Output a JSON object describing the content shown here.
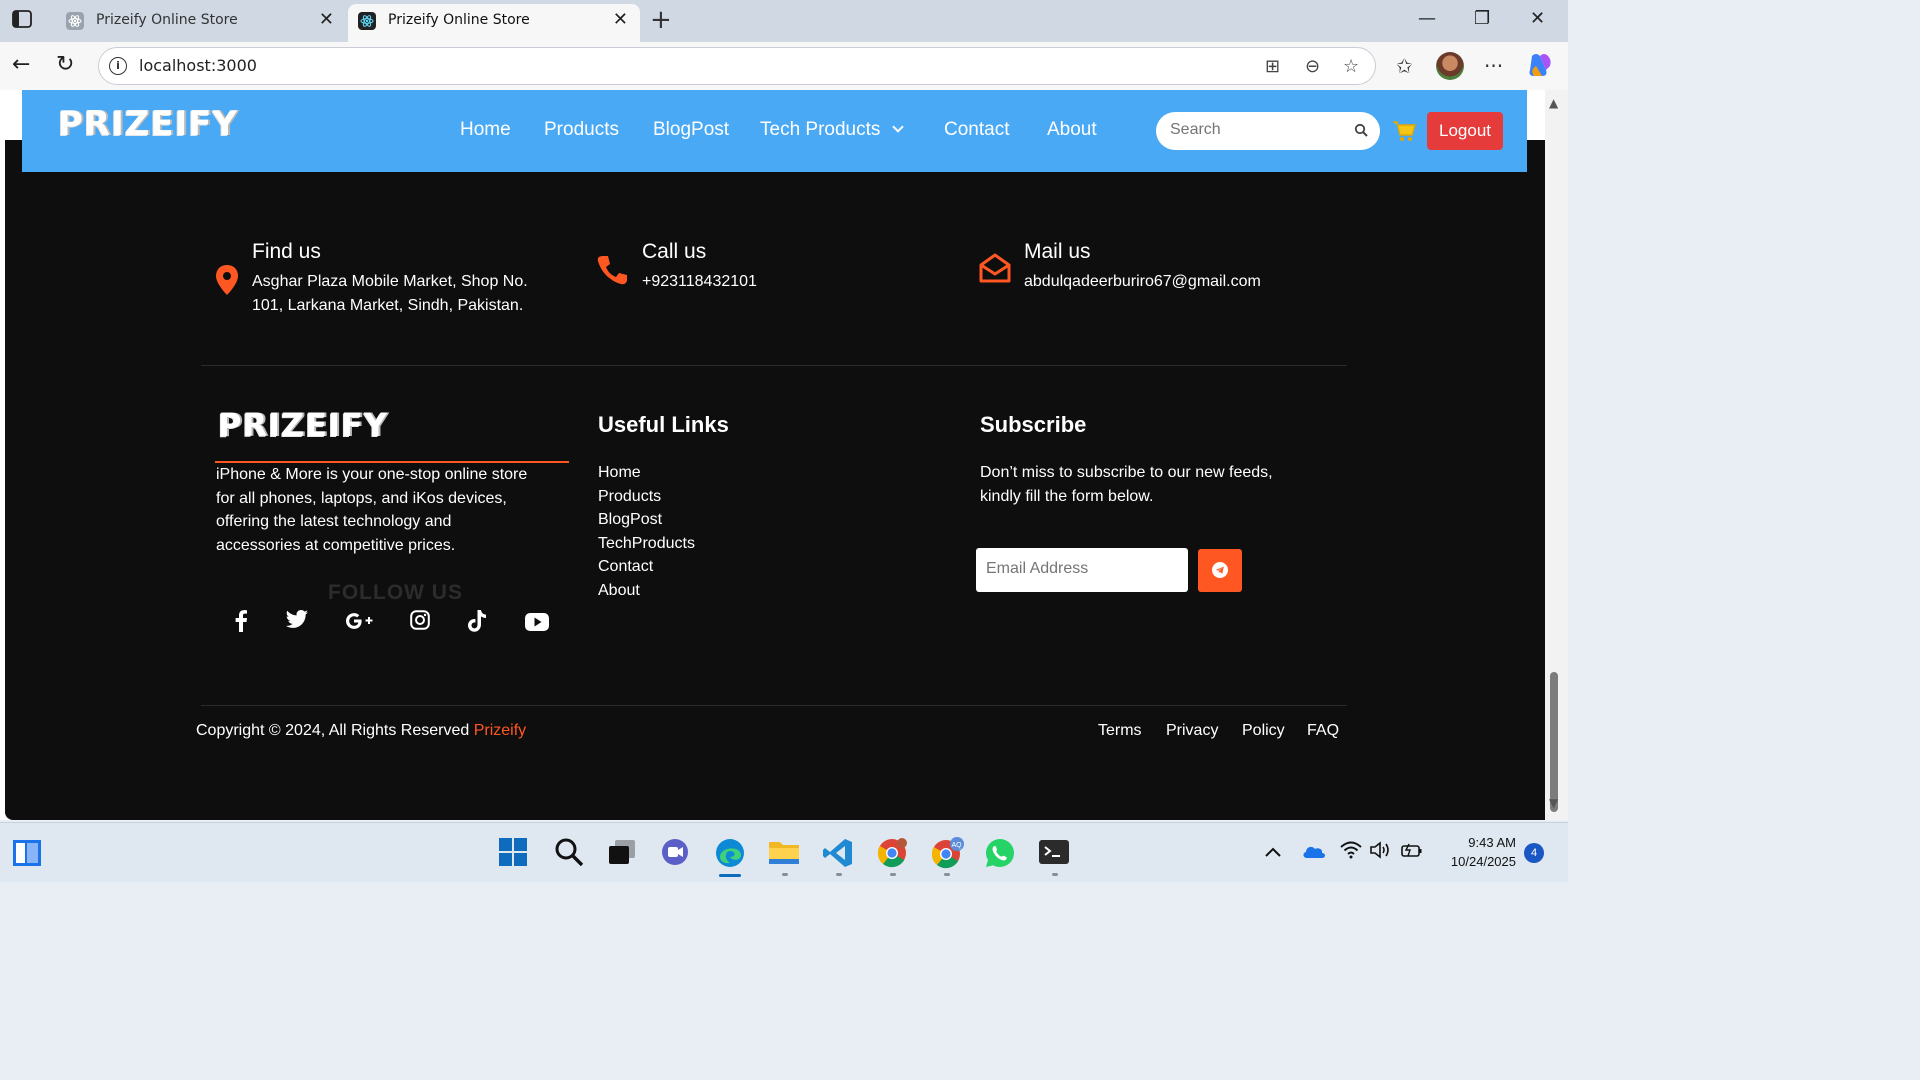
{
  "browser": {
    "tabs": [
      {
        "title": "Prizeify Online Store",
        "active": false
      },
      {
        "title": "Prizeify Online Store",
        "active": true
      }
    ],
    "url": "localhost:3000"
  },
  "site": {
    "logo": "PRIZEIFY",
    "nav": [
      "Home",
      "Products",
      "BlogPost",
      "Tech Products",
      "Contact",
      "About"
    ],
    "search_placeholder": "Search",
    "logout_label": "Logout",
    "accent_color": "#ff5722",
    "nav_color": "#4aa9f5"
  },
  "contact": {
    "find": {
      "title": "Find us",
      "line1": "Asghar Plaza Mobile Market, Shop No.",
      "line2": "101, Larkana Market, Sindh, Pakistan."
    },
    "call": {
      "title": "Call us",
      "value": "+923118432101"
    },
    "mail": {
      "title": "Mail us",
      "value": "abdulqadeerburiro67@gmail.com"
    }
  },
  "footer": {
    "logo": "PRIZEIFY",
    "about": [
      "iPhone & More is your one-stop online store",
      "for all phones, laptops, and iKos devices,",
      "offering the latest technology and",
      "accessories at competitive prices."
    ],
    "follow_title": "FOLLOW US",
    "social_icons": [
      "facebook-icon",
      "twitter-icon",
      "google-plus-icon",
      "instagram-icon",
      "tiktok-icon",
      "youtube-icon"
    ],
    "useful_links_title": "Useful Links",
    "useful_links": [
      "Home",
      "Products",
      "BlogPost",
      "TechProducts",
      "Contact",
      "About"
    ],
    "subscribe_title": "Subscribe",
    "subscribe_text_1": "Don’t miss to subscribe to our new feeds,",
    "subscribe_text_2": "kindly fill the form below.",
    "email_placeholder": "Email Address",
    "copyright": "Copyright © 2024, All Rights Reserved ",
    "copyright_brand": "Prizeify",
    "legal_links": [
      "Terms",
      "Privacy",
      "Policy",
      "FAQ"
    ]
  },
  "taskbar": {
    "time": "9:43 AM",
    "date": "10/24/2025",
    "notification_count": "4"
  }
}
